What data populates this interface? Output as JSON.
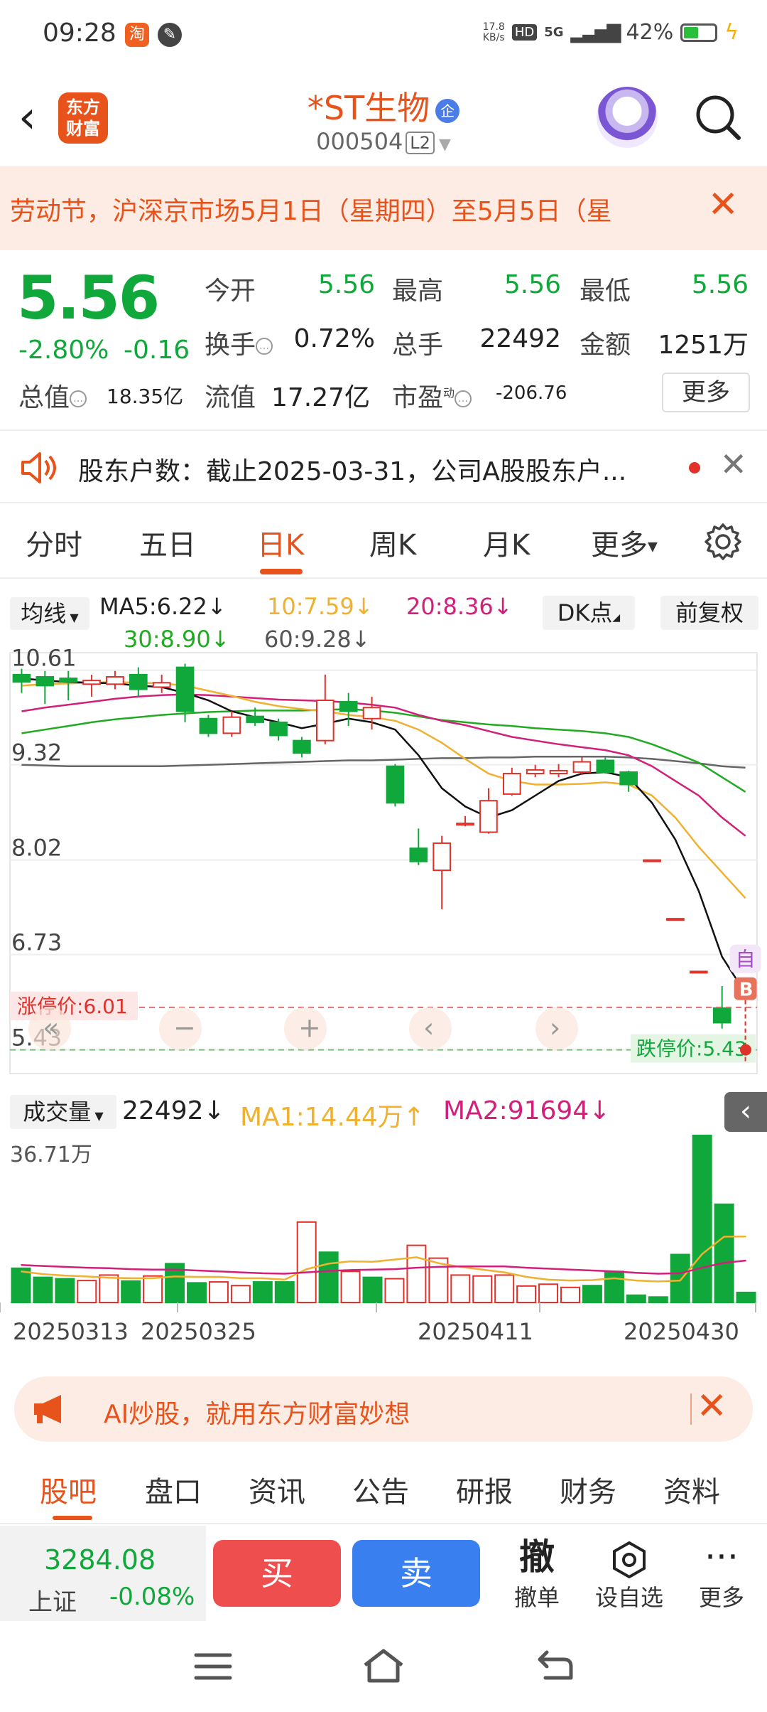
{
  "status_bar": {
    "time": "09:28",
    "app1": "淘",
    "net_speed_top": "17.8",
    "net_speed_bottom": "KB/s",
    "hd": "HD",
    "network": "5G",
    "battery": "42%"
  },
  "header": {
    "back": "‹",
    "logo": "东方\n财富",
    "stock_name": "*ST生物",
    "corp_badge": "企",
    "stock_code": "000504",
    "level": "L2"
  },
  "notice": {
    "text": "劳动节，沪深京市场5月1日（星期四）至5月5日（星"
  },
  "quote": {
    "price": "5.56",
    "change_pct": "-2.80%",
    "change": "-0.16",
    "open_label": "今开",
    "open": "5.56",
    "high_label": "最高",
    "high": "5.56",
    "low_label": "最低",
    "low": "5.56",
    "turnover_label": "换手",
    "turnover": "0.72%",
    "volume_label": "总手",
    "volume": "22492",
    "amount_label": "金额",
    "amount": "1251万",
    "mktcap_label": "总值",
    "mktcap": "18.35亿",
    "float_label": "流值",
    "float": "17.27亿",
    "pe_label": "市盈",
    "pe_sup": "动",
    "pe": "-206.76",
    "more": "更多"
  },
  "holder_notice": {
    "text": "股东户数：截止2025-03-31，公司A股股东户..."
  },
  "tabs": [
    {
      "label": "分时"
    },
    {
      "label": "五日"
    },
    {
      "label": "日K"
    },
    {
      "label": "周K"
    },
    {
      "label": "月K"
    },
    {
      "label": "更多"
    }
  ],
  "ma_legend": {
    "btn": "均线",
    "ma5": "MA5:6.22↓",
    "ma10": "10:7.59↓",
    "ma20": "20:8.36↓",
    "ma30": "30:8.90↓",
    "ma60": "60:9.28↓",
    "dk": "DK点",
    "fq": "前复权"
  },
  "chart_data": {
    "type": "candlestick",
    "y_ticks": [
      "10.61",
      "9.32",
      "8.02",
      "6.73",
      "5.43"
    ],
    "ylim": [
      5.43,
      10.61
    ],
    "limit_up": "涨停价:6.01",
    "limit_down": "跌停价:5.43",
    "marker_self": "自",
    "marker_b": "B",
    "colors": {
      "up": "#e0312b",
      "down": "#11a83b",
      "ma5": "#111111",
      "ma10": "#f0b030",
      "ma20": "#d0207a",
      "ma30": "#22aa22",
      "ma60": "#666666"
    },
    "candles": [
      {
        "o": 10.55,
        "c": 10.45,
        "h": 10.63,
        "l": 10.3
      },
      {
        "o": 10.52,
        "c": 10.4,
        "h": 10.6,
        "l": 10.15
      },
      {
        "o": 10.5,
        "c": 10.45,
        "h": 10.6,
        "l": 10.2
      },
      {
        "o": 10.42,
        "c": 10.47,
        "h": 10.55,
        "l": 10.25
      },
      {
        "o": 10.42,
        "c": 10.52,
        "h": 10.6,
        "l": 10.35
      },
      {
        "o": 10.55,
        "c": 10.35,
        "h": 10.65,
        "l": 10.25
      },
      {
        "o": 10.38,
        "c": 10.44,
        "h": 10.55,
        "l": 10.3
      },
      {
        "o": 10.65,
        "c": 10.05,
        "h": 10.7,
        "l": 9.9
      },
      {
        "o": 9.95,
        "c": 9.75,
        "h": 10.0,
        "l": 9.7
      },
      {
        "o": 9.75,
        "c": 9.97,
        "h": 10.05,
        "l": 9.7
      },
      {
        "o": 9.98,
        "c": 9.9,
        "h": 10.1,
        "l": 9.85
      },
      {
        "o": 9.9,
        "c": 9.72,
        "h": 9.95,
        "l": 9.65
      },
      {
        "o": 9.65,
        "c": 9.48,
        "h": 9.7,
        "l": 9.42
      },
      {
        "o": 9.65,
        "c": 10.2,
        "h": 10.55,
        "l": 9.6
      },
      {
        "o": 10.18,
        "c": 10.05,
        "h": 10.3,
        "l": 9.85
      },
      {
        "o": 9.95,
        "c": 10.1,
        "h": 10.25,
        "l": 9.8
      },
      {
        "o": 9.3,
        "c": 8.8,
        "h": 9.33,
        "l": 8.75
      },
      {
        "o": 8.18,
        "c": 8.0,
        "h": 8.45,
        "l": 7.95
      },
      {
        "o": 7.88,
        "c": 8.25,
        "h": 8.35,
        "l": 7.35
      },
      {
        "o": 8.5,
        "c": 8.52,
        "h": 8.62,
        "l": 8.48
      },
      {
        "o": 8.4,
        "c": 8.83,
        "h": 9.0,
        "l": 8.38
      },
      {
        "o": 8.92,
        "c": 9.2,
        "h": 9.28,
        "l": 8.9
      },
      {
        "o": 9.2,
        "c": 9.25,
        "h": 9.32,
        "l": 9.15
      },
      {
        "o": 9.2,
        "c": 9.24,
        "h": 9.33,
        "l": 9.15
      },
      {
        "o": 9.22,
        "c": 9.36,
        "h": 9.42,
        "l": 9.18
      },
      {
        "o": 9.38,
        "c": 9.22,
        "h": 9.42,
        "l": 9.2
      },
      {
        "o": 9.22,
        "c": 9.05,
        "h": 9.24,
        "l": 8.95
      },
      {
        "o": 8.02,
        "c": 8.02,
        "h": 8.02,
        "l": 8.02
      },
      {
        "o": 7.22,
        "c": 7.22,
        "h": 7.22,
        "l": 7.22
      },
      {
        "o": 6.5,
        "c": 6.5,
        "h": 6.5,
        "l": 6.5
      },
      {
        "o": 6.0,
        "c": 5.8,
        "h": 6.3,
        "l": 5.72
      },
      {
        "o": 5.56,
        "c": 5.56,
        "h": 5.56,
        "l": 5.56
      }
    ],
    "ma5": [
      10.5,
      10.47,
      10.45,
      10.44,
      10.43,
      10.4,
      10.38,
      10.3,
      10.2,
      10.05,
      9.97,
      9.9,
      9.82,
      9.88,
      9.95,
      9.9,
      9.8,
      9.45,
      9.0,
      8.75,
      8.6,
      8.7,
      8.9,
      9.1,
      9.2,
      9.22,
      9.15,
      8.8,
      8.3,
      7.6,
      6.7,
      6.2
    ],
    "ma10": [
      10.4,
      10.42,
      10.43,
      10.44,
      10.45,
      10.44,
      10.43,
      10.4,
      10.33,
      10.26,
      10.18,
      10.12,
      10.08,
      10.05,
      10.0,
      9.97,
      9.92,
      9.8,
      9.62,
      9.4,
      9.2,
      9.1,
      9.05,
      9.05,
      9.06,
      9.08,
      9.05,
      8.9,
      8.6,
      8.2,
      7.85,
      7.5
    ],
    "ma20": [
      10.05,
      10.1,
      10.14,
      10.18,
      10.22,
      10.25,
      10.27,
      10.28,
      10.27,
      10.25,
      10.23,
      10.21,
      10.2,
      10.19,
      10.17,
      10.14,
      10.1,
      10.0,
      9.92,
      9.86,
      9.78,
      9.7,
      9.65,
      9.6,
      9.56,
      9.52,
      9.45,
      9.3,
      9.1,
      8.9,
      8.6,
      8.35
    ],
    "ma30": [
      9.75,
      9.8,
      9.85,
      9.9,
      9.94,
      9.97,
      10.0,
      10.02,
      10.04,
      10.05,
      10.06,
      10.06,
      10.06,
      10.07,
      10.08,
      10.06,
      10.03,
      9.98,
      9.93,
      9.9,
      9.87,
      9.85,
      9.82,
      9.8,
      9.78,
      9.75,
      9.7,
      9.6,
      9.48,
      9.35,
      9.15,
      8.95
    ],
    "ma60": [
      9.32,
      9.31,
      9.3,
      9.3,
      9.3,
      9.3,
      9.3,
      9.31,
      9.32,
      9.33,
      9.34,
      9.35,
      9.36,
      9.37,
      9.38,
      9.38,
      9.39,
      9.4,
      9.41,
      9.41,
      9.42,
      9.42,
      9.43,
      9.43,
      9.43,
      9.43,
      9.42,
      9.4,
      9.37,
      9.34,
      9.3,
      9.28
    ],
    "volume": {
      "title": "成交量",
      "current": "22492↓",
      "ma1": "MA1:14.44万↑",
      "ma2": "MA2:91694↓",
      "max_label": "36.71万",
      "values": [
        7.5,
        5.5,
        5.2,
        4.8,
        6.0,
        4.7,
        5.8,
        8.5,
        4.3,
        4.5,
        3.7,
        4.5,
        4.5,
        17.6,
        11.0,
        6.8,
        5.5,
        5.2,
        12.5,
        9.7,
        6.0,
        5.8,
        6.0,
        3.6,
        4.0,
        3.3,
        3.7,
        6.8,
        1.6,
        1.2,
        10.5,
        36.71,
        21.5,
        2.2
      ],
      "ma1_line": [
        6.8,
        6.2,
        5.9,
        5.7,
        5.4,
        5.3,
        5.3,
        5.7,
        5.6,
        5.6,
        5.3,
        5.3,
        5.0,
        7.3,
        8.5,
        9.0,
        8.9,
        9.4,
        9.9,
        8.6,
        7.8,
        7.2,
        6.6,
        5.6,
        5.0,
        4.8,
        4.9,
        5.3,
        4.8,
        4.6,
        4.8,
        10.6,
        14.4,
        14.44
      ],
      "ma2_line": [
        8.2,
        8.0,
        7.8,
        7.6,
        7.5,
        7.3,
        7.2,
        7.2,
        7.0,
        6.8,
        6.6,
        6.4,
        6.3,
        6.6,
        6.9,
        7.1,
        7.2,
        7.3,
        7.6,
        7.8,
        7.9,
        7.9,
        7.9,
        7.6,
        7.4,
        7.2,
        7.0,
        6.8,
        6.5,
        6.3,
        6.4,
        7.6,
        8.7,
        9.17
      ],
      "up_flags": [
        0,
        0,
        0,
        1,
        1,
        0,
        1,
        0,
        0,
        1,
        1,
        0,
        0,
        1,
        0,
        1,
        0,
        1,
        1,
        1,
        1,
        1,
        1,
        1,
        1,
        1,
        0,
        0,
        0,
        0,
        0,
        0,
        0,
        0
      ],
      "dates": [
        "20250313",
        "20250325",
        "20250411",
        "20250430"
      ]
    }
  },
  "ad_banner": {
    "text": "AI炒股，就用东方财富妙想"
  },
  "bottom_tabs": [
    {
      "label": "股吧"
    },
    {
      "label": "盘口"
    },
    {
      "label": "资讯"
    },
    {
      "label": "公告"
    },
    {
      "label": "研报"
    },
    {
      "label": "财务"
    },
    {
      "label": "资料"
    }
  ],
  "trade_bar": {
    "index_value": "3284.08",
    "index_name": "上证",
    "index_change": "-0.08%",
    "buy": "买",
    "sell": "卖",
    "cancel_icon": "撤",
    "cancel": "撤单",
    "watch": "设自选",
    "more": "更多"
  }
}
